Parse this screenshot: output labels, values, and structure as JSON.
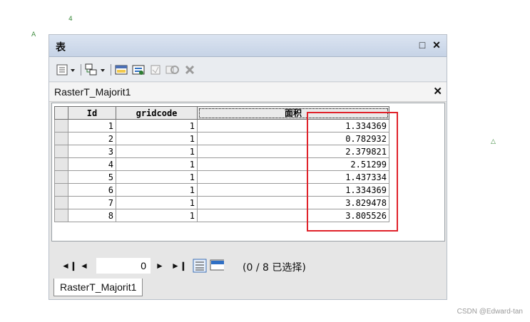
{
  "window": {
    "title": "表"
  },
  "toolbar": {
    "table_options": "table-options-icon",
    "related_tables": "related-tables-icon"
  },
  "table": {
    "name": "RasterT_Majorit1",
    "columns": [
      "Id",
      "gridcode",
      "面积"
    ],
    "rows": [
      [
        "1",
        "1",
        "1.334369"
      ],
      [
        "2",
        "1",
        "0.782932"
      ],
      [
        "3",
        "1",
        "2.379821"
      ],
      [
        "4",
        "1",
        "2.51299"
      ],
      [
        "5",
        "1",
        "1.437334"
      ],
      [
        "6",
        "1",
        "1.334369"
      ],
      [
        "7",
        "1",
        "3.829478"
      ],
      [
        "8",
        "1",
        "3.805526"
      ]
    ]
  },
  "status": {
    "record": "0",
    "selection": "(0 / 8 已选择)"
  },
  "tab": {
    "label": "RasterT_Majorit1"
  },
  "watermark": "CSDN @Edward-tan",
  "colors": {
    "highlight": "#e0222a"
  }
}
